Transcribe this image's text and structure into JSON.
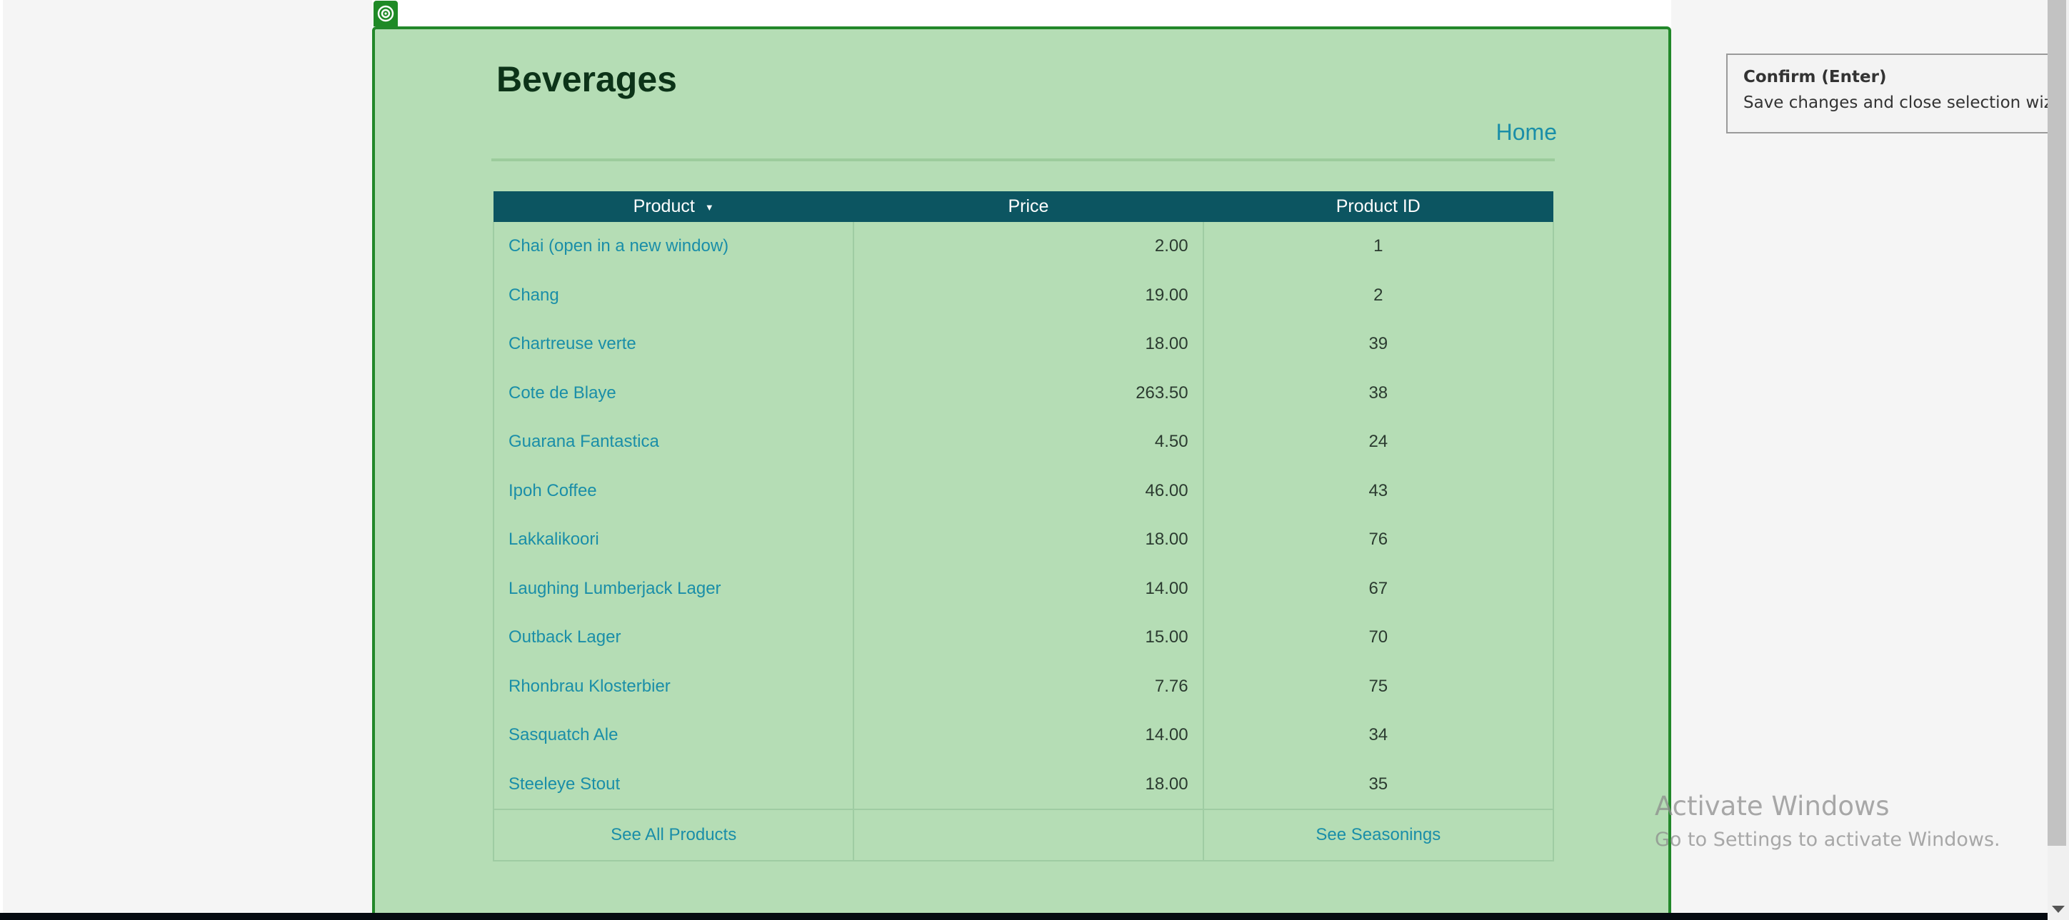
{
  "page": {
    "title": "Beverages",
    "home_link": "Home"
  },
  "table": {
    "headers": {
      "product": "Product",
      "price": "Price",
      "product_id": "Product ID"
    },
    "sort_indicator": "▼",
    "rows": [
      {
        "product": "Chai  (open in a new window)",
        "price": "2.00",
        "id": "1"
      },
      {
        "product": "Chang",
        "price": "19.00",
        "id": "2"
      },
      {
        "product": "Chartreuse verte",
        "price": "18.00",
        "id": "39"
      },
      {
        "product": "Cote de Blaye",
        "price": "263.50",
        "id": "38"
      },
      {
        "product": "Guarana Fantastica",
        "price": "4.50",
        "id": "24"
      },
      {
        "product": "Ipoh Coffee",
        "price": "46.00",
        "id": "43"
      },
      {
        "product": "Lakkalikoori",
        "price": "18.00",
        "id": "76"
      },
      {
        "product": "Laughing Lumberjack Lager",
        "price": "14.00",
        "id": "67"
      },
      {
        "product": "Outback Lager",
        "price": "15.00",
        "id": "70"
      },
      {
        "product": "Rhonbrau Klosterbier",
        "price": "7.76",
        "id": "75"
      },
      {
        "product": "Sasquatch Ale",
        "price": "14.00",
        "id": "34"
      },
      {
        "product": "Steeleye Stout",
        "price": "18.00",
        "id": "35"
      }
    ],
    "footer": {
      "see_all": "See All Products",
      "see_seasonings": "See Seasonings"
    }
  },
  "tooltip": {
    "title": "Confirm (Enter)",
    "body": "Save changes and close selection wizard."
  },
  "watermark": {
    "title": "Activate Windows",
    "subtitle": "Go to Settings to activate Windows."
  },
  "colors": {
    "selection_fill": "#b5ddb5",
    "selection_border": "#22882a",
    "header_bg": "#0c5561",
    "link": "#1a8ea8"
  },
  "icons": {
    "selection_handle": "target-icon",
    "sort": "sort-down-icon"
  }
}
